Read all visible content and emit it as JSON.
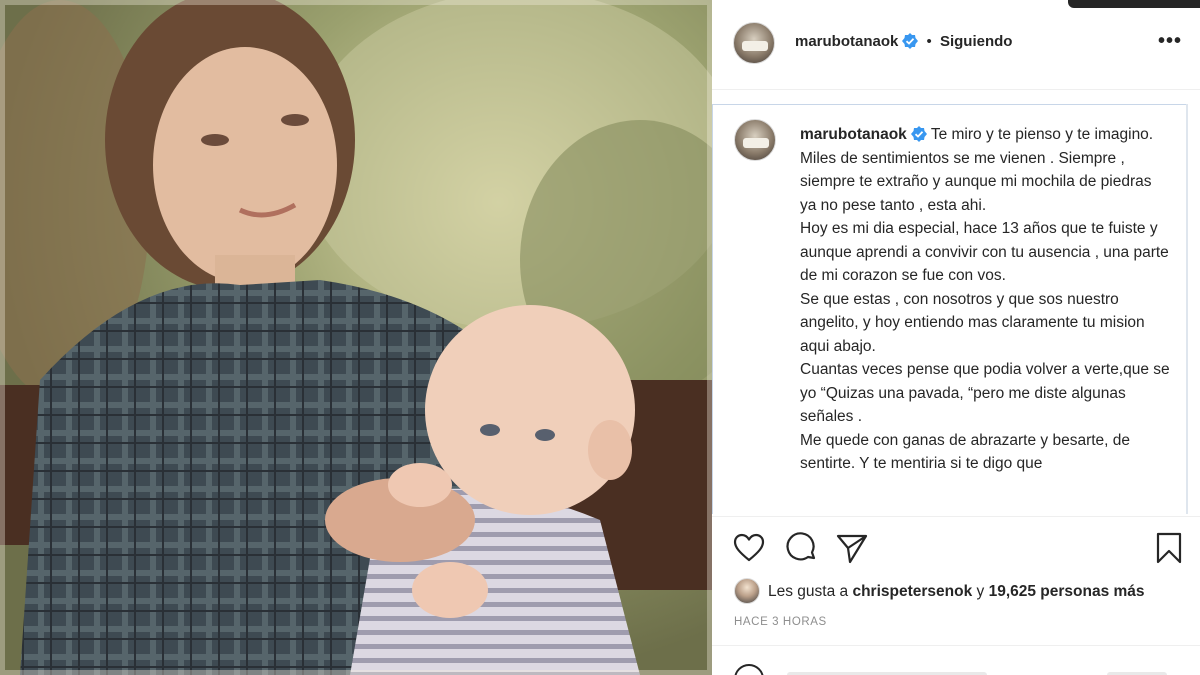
{
  "post": {
    "username": "marubotanaok",
    "separator": "•",
    "follow_status": "Siguiendo",
    "more_label": "•••"
  },
  "caption": {
    "username": "marubotanaok",
    "paragraphs": [
      "Te miro y te pienso y te imagino. Miles de sentimientos se me vienen . Siempre , siempre te extraño y aunque mi mochila de piedras ya no pese tanto , esta ahi.",
      "Hoy es mi dia especial, hace 13 años que te fuiste y aunque aprendi a convivir con tu ausencia , una parte de mi corazon se fue con vos.",
      "Se que estas , con nosotros y que sos nuestro angelito, y hoy entiendo mas claramente tu mision aqui abajo.",
      "Cuantas veces pense que podia volver a verte,que se yo “Quizas una pavada, “pero me diste algunas señales .",
      "Me quede con ganas de abrazarte y besarte, de sentirte. Y te mentiria si te digo que"
    ]
  },
  "actions": {
    "like_icon": "heart-icon",
    "comment_icon": "comment-icon",
    "share_icon": "paper-plane-icon",
    "save_icon": "bookmark-icon"
  },
  "likes": {
    "prefix": "Les gusta a ",
    "user": "chrispetersenok",
    "connector": " y ",
    "count_text": "19,625 personas más"
  },
  "timestamp": "HACE 3 HORAS",
  "colors": {
    "text": "#262626",
    "muted": "#8e8e8e",
    "verified": "#3897f0",
    "border": "#efefef"
  }
}
